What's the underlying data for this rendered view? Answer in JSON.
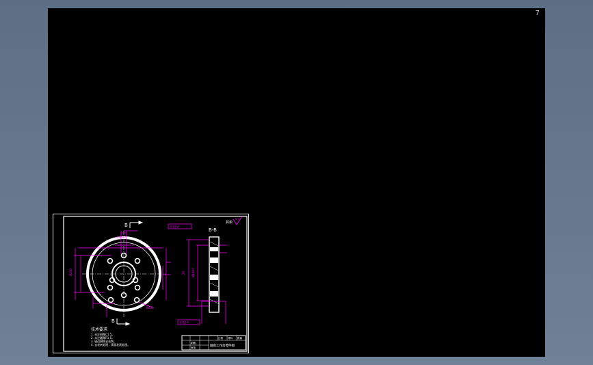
{
  "viewport": {
    "corner_mark": "7",
    "background": "#000000"
  },
  "colors": {
    "frame": "#ffffff",
    "dimension": "#ff00ff",
    "note": "#ffffff",
    "hatch": "#ffffff"
  },
  "drawing": {
    "section_top_label": "B",
    "section_bottom_label": "B",
    "section_view_title": "B-B",
    "roughness_note": "其余",
    "roughness_value": "6.3",
    "tolerance_top": "0.02 A",
    "tolerance_bottom": "0.02 A",
    "dim_diameter_outer": "Ø250",
    "dim_diameter_inner": "Ø120",
    "dim_hole_pattern": "4×Ø12",
    "dim_thickness": "20",
    "dim_small_hole": "Ø40H7",
    "tech_requirements": {
      "title": "技术要求",
      "items": [
        "1. 未注倒角C1.5。",
        "2. 未注圆角R1.5。",
        "3. 锐边倒钝去毛刺。",
        "4. 去毛刺处理，表面发黑处理。"
      ]
    },
    "title_block": {
      "part_name": "圆盘工作台零件图",
      "label_scale": "比例",
      "label_material": "材料",
      "label_qty": "数量",
      "label_drawn": "制图",
      "label_checked": "审核"
    }
  }
}
